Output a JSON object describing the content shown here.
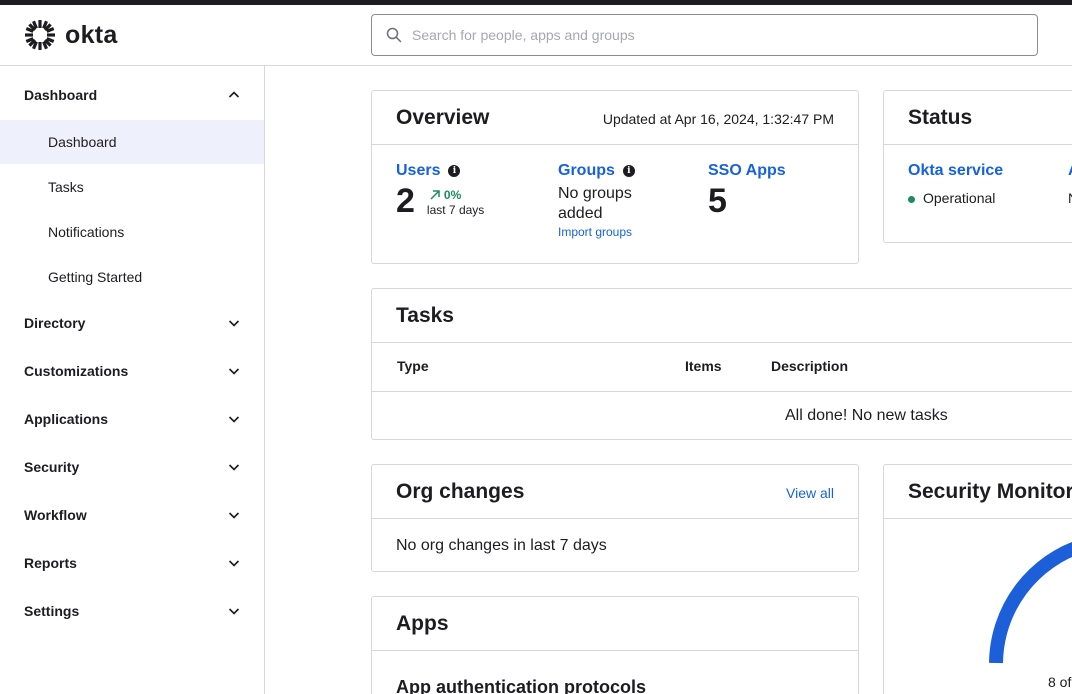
{
  "brand": {
    "name": "okta"
  },
  "search": {
    "placeholder": "Search for people, apps and groups"
  },
  "sidebar": {
    "groups": [
      {
        "label": "Dashboard",
        "expanded": true,
        "items": [
          {
            "label": "Dashboard",
            "active": true
          },
          {
            "label": "Tasks"
          },
          {
            "label": "Notifications"
          },
          {
            "label": "Getting Started"
          }
        ]
      },
      {
        "label": "Directory"
      },
      {
        "label": "Customizations"
      },
      {
        "label": "Applications"
      },
      {
        "label": "Security"
      },
      {
        "label": "Workflow"
      },
      {
        "label": "Reports"
      },
      {
        "label": "Settings"
      }
    ]
  },
  "overview": {
    "title": "Overview",
    "updated": "Updated at Apr 16, 2024, 1:32:47 PM",
    "users": {
      "label": "Users",
      "value": "2",
      "change": "0%",
      "period": "last 7 days"
    },
    "groups": {
      "label": "Groups",
      "empty_line1": "No groups",
      "empty_line2": "added",
      "action": "Import groups"
    },
    "sso": {
      "label": "SSO Apps",
      "value": "5"
    }
  },
  "status": {
    "title": "Status",
    "service_label": "Okta service",
    "service_state": "Operational",
    "second_label_fragment": "A",
    "second_state_fragment": "N"
  },
  "tasks": {
    "title": "Tasks",
    "columns": [
      "Type",
      "Items",
      "Description"
    ],
    "empty": "All done! No new tasks"
  },
  "org_changes": {
    "title": "Org changes",
    "view_all": "View all",
    "empty": "No org changes in last 7 days"
  },
  "apps": {
    "title": "Apps",
    "subtitle": "App authentication protocols"
  },
  "security_monitor": {
    "title": "Security Monitor",
    "score_fragment": "8 of"
  },
  "colors": {
    "link": "#1662dd",
    "accent_green": "#1a8d5f",
    "active_nav_bg": "#eef0fb",
    "gauge": "#1d5fd8"
  }
}
